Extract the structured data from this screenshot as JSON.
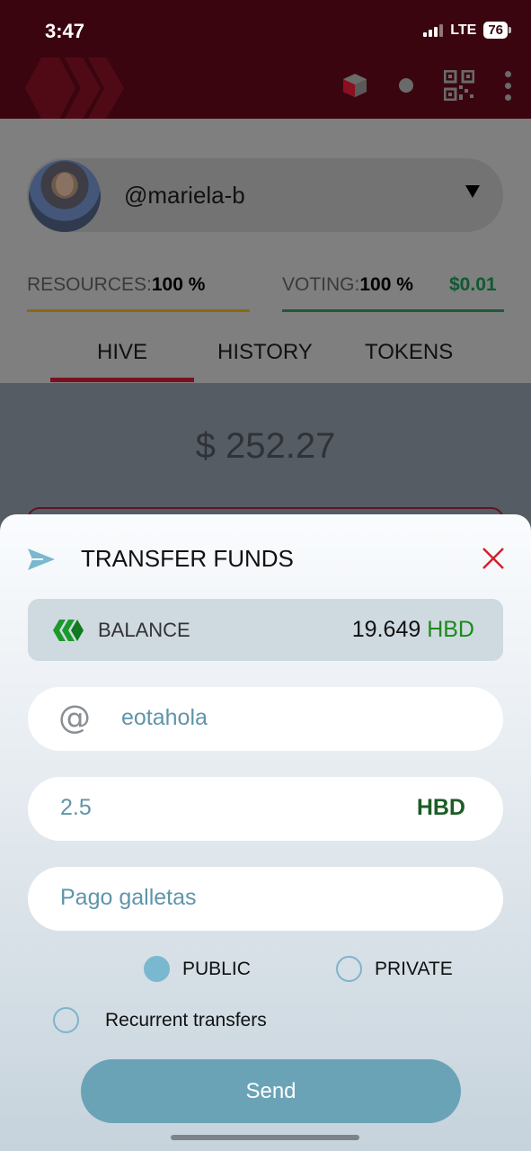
{
  "status_bar": {
    "time": "3:47",
    "network": "LTE",
    "battery": "76"
  },
  "app": {
    "account": {
      "username": "@mariela-b"
    },
    "resources": {
      "label": "RESOURCES:",
      "value": "100 %"
    },
    "voting": {
      "label": "VOTING:",
      "value": "100 %",
      "usd": "$0.01"
    },
    "tabs": [
      {
        "label": "HIVE"
      },
      {
        "label": "HISTORY"
      },
      {
        "label": "TOKENS"
      }
    ],
    "total_balance": "$ 252.27"
  },
  "transfer": {
    "title": "TRANSFER FUNDS",
    "balance_label": "BALANCE",
    "balance_value": "19.649",
    "balance_currency": "HBD",
    "to_value": "eotahola",
    "amount_value": "2.5",
    "amount_currency": "HBD",
    "memo_value": "Pago galletas",
    "visibility_options": [
      {
        "label": "PUBLIC",
        "selected": true
      },
      {
        "label": "PRIVATE",
        "selected": false
      }
    ],
    "recurrent_label": "Recurrent transfers",
    "send_label": "Send"
  },
  "colors": {
    "accent": "#7ab8d0",
    "hbd_green": "#1a8a1a",
    "brand": "#3b0510",
    "close": "#d0212f"
  }
}
